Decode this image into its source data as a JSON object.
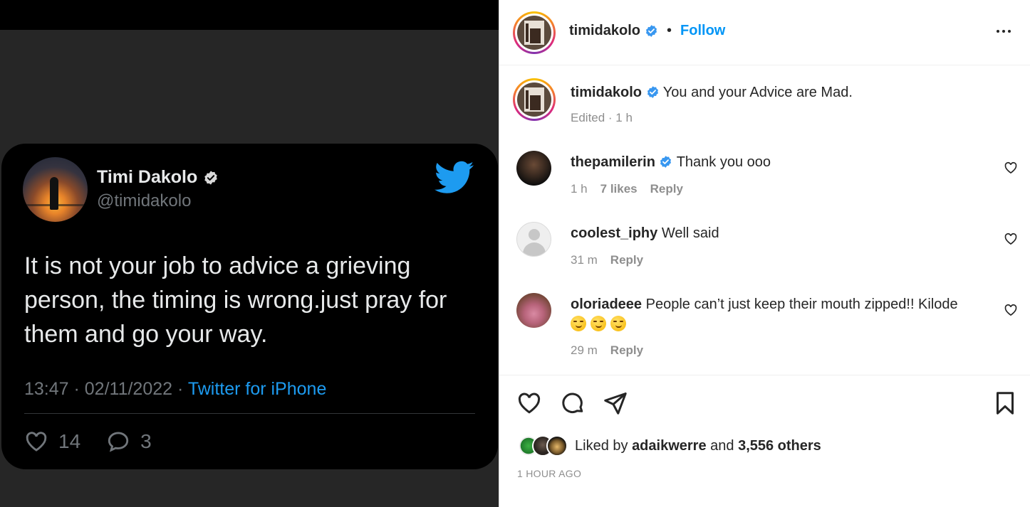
{
  "tweet": {
    "name": "Timi Dakolo",
    "handle": "@timidakolo",
    "text": "It is not your job to advice a grieving person, the timing is wrong.just pray for them and go your way.",
    "time": "13:47 · 02/11/2022 · ",
    "source": "Twitter for iPhone",
    "likes": "14",
    "replies": "3",
    "colors": {
      "link": "#1d9bf0",
      "text": "#e7e9ea",
      "muted": "#71767b"
    }
  },
  "post": {
    "author": "timidakolo",
    "follow_label": "Follow",
    "separator": "•",
    "caption": "You and your Advice are Mad.",
    "caption_meta": "Edited · 1 h",
    "comments": [
      {
        "user": "thepamilerin",
        "text": "Thank you ooo",
        "time": "1 h",
        "likes": "7 likes",
        "reply": "Reply"
      },
      {
        "user": "coolest_iphy",
        "text": "Well said",
        "time": "31 m",
        "reply": "Reply"
      },
      {
        "user": "oloriadeee",
        "text": "People can’t just keep their mouth zipped!! Kilode",
        "time": "29 m",
        "reply": "Reply"
      }
    ],
    "liked_by_prefix": "Liked by",
    "liked_by_user": "adaikwerre",
    "liked_by_and": "and",
    "liked_by_others": "3,556 others",
    "timestamp": "1 HOUR AGO",
    "colors": {
      "accent": "#0095f6",
      "verified": "#3897f0",
      "muted": "#8e8e8e"
    }
  },
  "icons": [
    "verified-badge-icon",
    "twitter-bird-icon",
    "heart-icon",
    "comment-icon",
    "share-icon",
    "bookmark-icon",
    "more-options-icon",
    "smiling-emoji-icon"
  ]
}
